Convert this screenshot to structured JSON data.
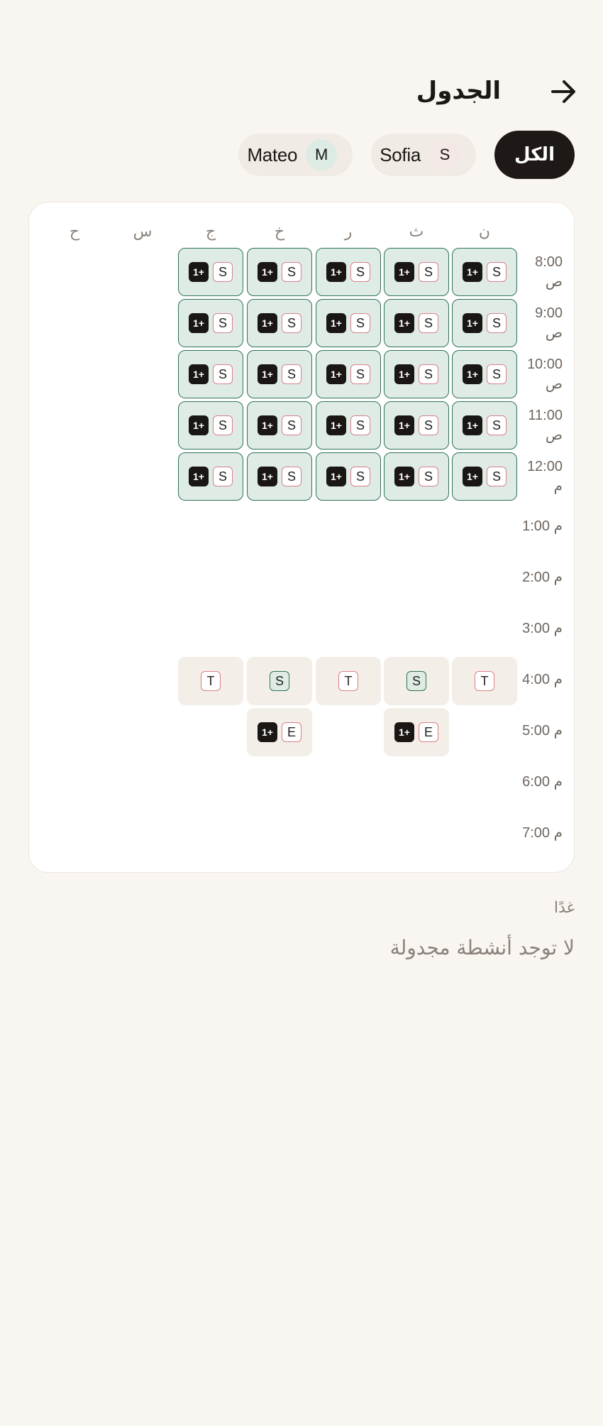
{
  "header": {
    "title": "الجدول",
    "back_icon": "arrow-right-icon"
  },
  "filters": {
    "all_label": "الكل",
    "people": [
      {
        "name": "Sofia",
        "initial": "S"
      },
      {
        "name": "Mateo",
        "initial": "M"
      }
    ]
  },
  "schedule": {
    "days": [
      "ن",
      "ث",
      "ر",
      "خ",
      "ج",
      "س",
      "ح"
    ],
    "times": [
      "8:00 ص",
      "9:00 ص",
      "10:00 ص",
      "11:00 ص",
      "12:00 م",
      "1:00 م",
      "2:00 م",
      "3:00 م",
      "4:00 م",
      "5:00 م",
      "6:00 م",
      "7:00 م"
    ],
    "morning_badges": {
      "count": "1+",
      "initial": "S"
    },
    "afternoon_4pm": [
      "T",
      "S",
      "T",
      "S",
      "T"
    ],
    "afternoon_5pm": {
      "initial": "E",
      "count": "1+"
    }
  },
  "tomorrow": {
    "label": "غدًا",
    "empty_message": "لا توجد أنشطة مجدولة"
  },
  "colors": {
    "background": "#f9f6f2",
    "accent_dark": "#1e1916",
    "slot_green": "#dfece5",
    "slot_border": "#2e7255",
    "badge_pink": "#d9808a",
    "slot_beige": "#f3eee7"
  }
}
